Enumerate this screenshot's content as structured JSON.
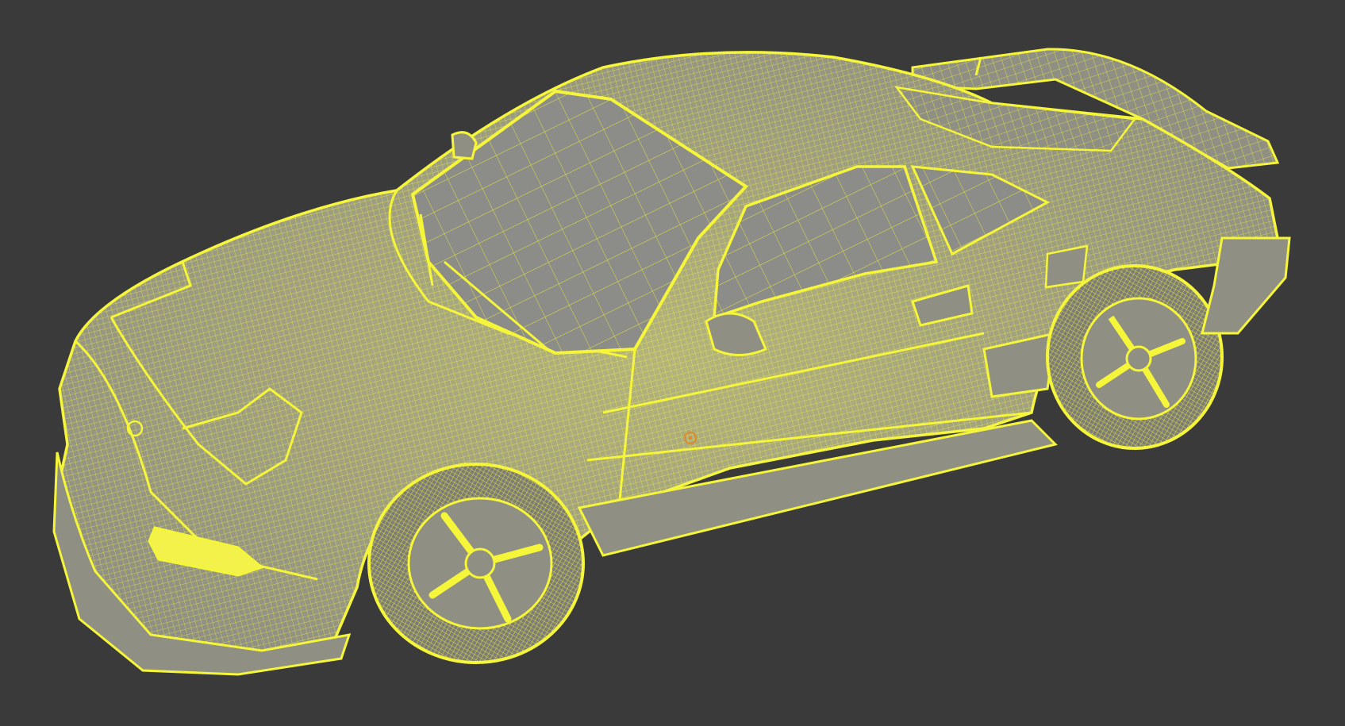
{
  "viewport": {
    "background_color": "#3a3a3a",
    "wire_color": "#f5f53a",
    "surface_color": "#8f8f84",
    "glass_color": "#8c8c88",
    "tire_color": "#7d7d76"
  },
  "object": {
    "type": "car-wireframe-mesh",
    "selected": true
  },
  "icons": [
    "origin-icon"
  ]
}
